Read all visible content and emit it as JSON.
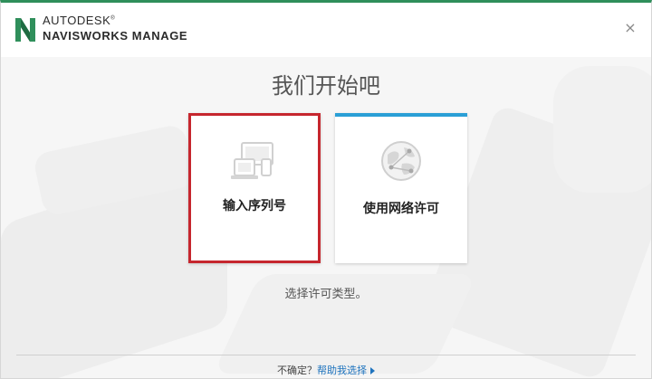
{
  "header": {
    "brand_line1": "AUTODESK",
    "brand_line2": "NAVISWORKS MANAGE",
    "close_symbol": "×",
    "accent_color": "#2f8f5b"
  },
  "main": {
    "title": "我们开始吧",
    "options": [
      {
        "label": "输入序列号",
        "icon": "devices-icon",
        "selected": true,
        "highlight_color": "#c6262e"
      },
      {
        "label": "使用网络许可",
        "icon": "network-globe-icon",
        "accent_color": "#2a9fd6"
      }
    ],
    "subtitle": "选择许可类型。"
  },
  "footer": {
    "question": "不确定？",
    "help_link": "帮助我选择"
  }
}
